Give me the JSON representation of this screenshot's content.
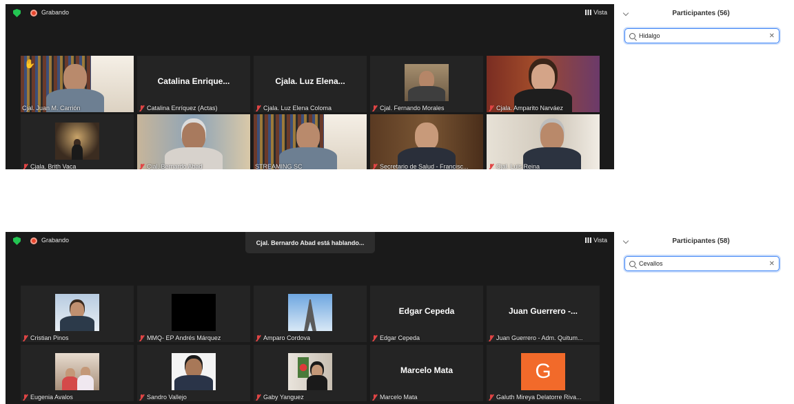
{
  "screens": [
    {
      "recording": "Grabando",
      "view": "Vista",
      "speaking": "",
      "panel": {
        "title": "Participantes (56)",
        "search": "Hidalgo"
      },
      "tiles": [
        {
          "name": "Cjal. Juan M. Carrión",
          "muted": false,
          "title": "",
          "active": true,
          "hand": true,
          "art": "books-man"
        },
        {
          "name": "Catalina Enríquez (Actas)",
          "muted": true,
          "title": "Catalina Enrique...",
          "art": ""
        },
        {
          "name": "Cjala. Luz Elena Coloma",
          "muted": true,
          "title": "Cjala. Luz Elena...",
          "art": ""
        },
        {
          "name": "Cjal. Fernando Morales",
          "muted": true,
          "title": "",
          "art": "thumb-man"
        },
        {
          "name": "Cjala. Amparito Narváez",
          "muted": true,
          "title": "",
          "art": "woman-full"
        },
        {
          "name": "Cjala. Brith Vaca",
          "muted": true,
          "title": "",
          "art": "thumb-night"
        },
        {
          "name": "Cjal. Bernardo Abad",
          "muted": true,
          "title": "",
          "art": "man-full"
        },
        {
          "name": "STREAMING SC",
          "muted": false,
          "title": "",
          "art": "books-man"
        },
        {
          "name": "Secretario de Salud - Francisc...",
          "muted": true,
          "title": "",
          "art": "office-man"
        },
        {
          "name": "Cjal. Luis Reina",
          "muted": true,
          "title": "",
          "art": "phone-man"
        }
      ]
    },
    {
      "recording": "Grabando",
      "view": "Vista",
      "speaking": "Cjal. Bernardo Abad está hablando...",
      "panel": {
        "title": "Participantes (58)",
        "search": "Cevallos"
      },
      "tiles": [
        {
          "name": "Cristian Pinos",
          "muted": true,
          "title": "",
          "art": "thumb-snow"
        },
        {
          "name": "MMQ- EP Andrés Márquez",
          "muted": true,
          "title": "",
          "art": "thumb-black"
        },
        {
          "name": "Amparo Cordova",
          "muted": true,
          "title": "",
          "art": "thumb-tower"
        },
        {
          "name": "Edgar Cepeda",
          "muted": true,
          "title": "Edgar Cepeda",
          "art": ""
        },
        {
          "name": "Juan Guerrero - Adm. Quitum...",
          "muted": true,
          "title": "Juan Guerrero -...",
          "art": ""
        },
        {
          "name": "Eugenia Avalos",
          "muted": true,
          "title": "",
          "art": "thumb-family"
        },
        {
          "name": "Sandro Vallejo",
          "muted": true,
          "title": "",
          "art": "thumb-suit"
        },
        {
          "name": "Gaby Yanguez",
          "muted": true,
          "title": "",
          "art": "thumb-flowers"
        },
        {
          "name": "Marcelo Mata",
          "muted": true,
          "title": "Marcelo Mata",
          "art": ""
        },
        {
          "name": "Galuth Mireya Delatorre Riva...",
          "muted": true,
          "title": "",
          "art": "letter",
          "letter": "G"
        }
      ]
    }
  ]
}
